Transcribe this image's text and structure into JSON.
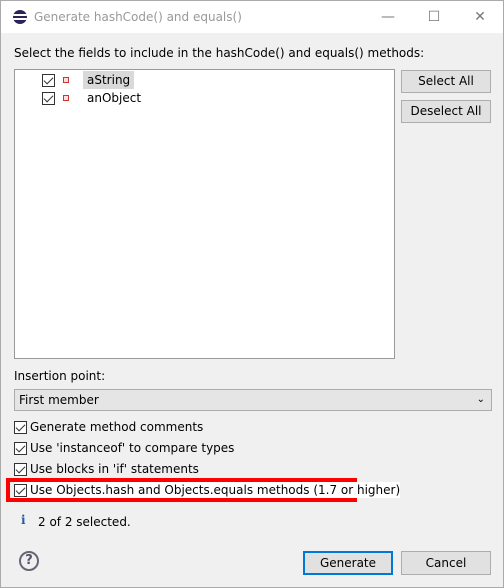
{
  "window": {
    "title": "Generate hashCode() and equals()",
    "controls": [
      "minimize",
      "maximize",
      "close"
    ]
  },
  "instruction": "Select the fields to include in the hashCode() and equals() methods:",
  "fields": [
    {
      "name": "aString",
      "checked": true,
      "selected": true
    },
    {
      "name": "anObject",
      "checked": true,
      "selected": false
    }
  ],
  "buttons": {
    "select_all": "Select All",
    "deselect_all": "Deselect All",
    "generate": "Generate",
    "cancel": "Cancel"
  },
  "insertion": {
    "label": "Insertion point:",
    "value": "First member"
  },
  "options": [
    {
      "label": "Generate method comments",
      "checked": true
    },
    {
      "label": "Use 'instanceof' to compare types",
      "checked": true
    },
    {
      "label": "Use blocks in 'if' statements",
      "checked": true
    },
    {
      "label": "Use Objects.hash and Objects.equals methods (1.7 or higher)",
      "checked": true,
      "highlighted": true
    }
  ],
  "status": "2 of 2 selected.",
  "icons": {
    "app": "eclipse-icon",
    "info": "info-icon",
    "help": "help-icon"
  },
  "colors": {
    "highlight": "#ff0000",
    "default_button_border": "#0078d7"
  }
}
